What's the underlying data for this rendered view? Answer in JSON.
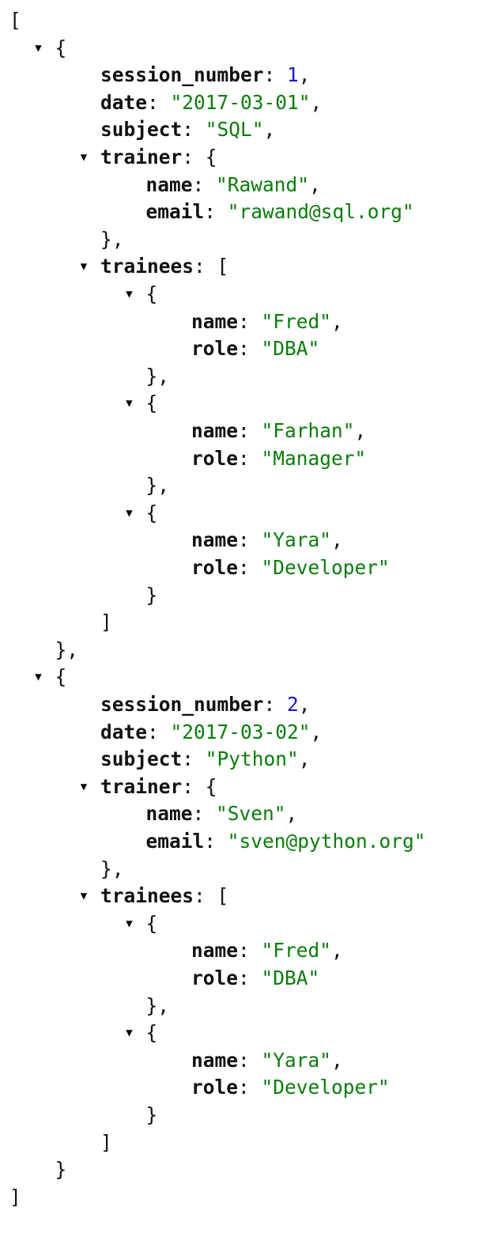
{
  "colors": {
    "background": "#ffffff",
    "key": "#111111",
    "string": "#0a7d0a",
    "number": "#1a1acc",
    "punctuation": "#111111"
  },
  "icons": {
    "expanded_toggle": "triangle-down-icon"
  },
  "sessions": [
    {
      "session_number": "1",
      "date": "\"2017-03-01\"",
      "subject": "\"SQL\"",
      "trainer": {
        "name": "\"Rawand\"",
        "email": "\"rawand@sql.org\""
      },
      "trainees": [
        {
          "name": "\"Fred\"",
          "role": "\"DBA\""
        },
        {
          "name": "\"Farhan\"",
          "role": "\"Manager\""
        },
        {
          "name": "\"Yara\"",
          "role": "\"Developer\""
        }
      ]
    },
    {
      "session_number": "2",
      "date": "\"2017-03-02\"",
      "subject": "\"Python\"",
      "trainer": {
        "name": "\"Sven\"",
        "email": "\"sven@python.org\""
      },
      "trainees": [
        {
          "name": "\"Fred\"",
          "role": "\"DBA\""
        },
        {
          "name": "\"Yara\"",
          "role": "\"Developer\""
        }
      ]
    }
  ]
}
